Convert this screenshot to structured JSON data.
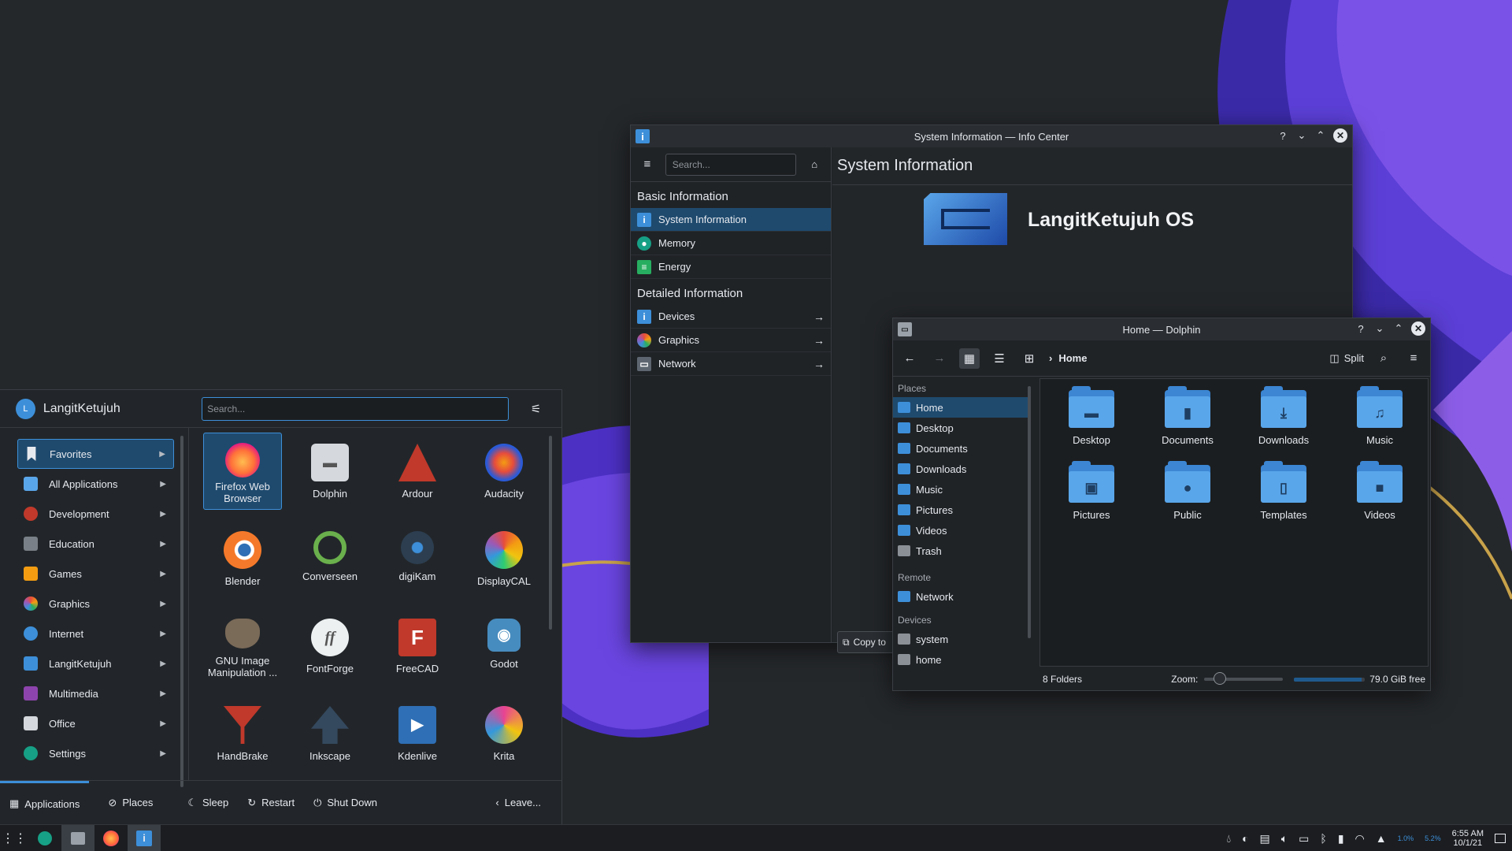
{
  "info_center": {
    "title": "System Information — Info Center",
    "search_placeholder": "Search...",
    "heading": "System Information",
    "basic_header": "Basic Information",
    "detailed_header": "Detailed Information",
    "basic_items": [
      {
        "label": "System Information",
        "icon": "info-icon"
      },
      {
        "label": "Memory",
        "icon": "memory-icon"
      },
      {
        "label": "Energy",
        "icon": "battery-icon"
      }
    ],
    "detailed_items": [
      {
        "label": "Devices",
        "icon": "info-icon"
      },
      {
        "label": "Graphics",
        "icon": "graphics-icon"
      },
      {
        "label": "Network",
        "icon": "network-icon"
      }
    ],
    "os_name": "LangitKetujuh OS",
    "copy_label": "Copy to"
  },
  "dolphin": {
    "title": "Home — Dolphin",
    "breadcrumb": "Home",
    "split_label": "Split",
    "places_header": "Places",
    "places": [
      "Home",
      "Desktop",
      "Documents",
      "Downloads",
      "Music",
      "Pictures",
      "Videos",
      "Trash"
    ],
    "remote_header": "Remote",
    "remote": [
      "Network"
    ],
    "devices_header": "Devices",
    "devices": [
      "system",
      "home"
    ],
    "folders": [
      {
        "name": "Desktop",
        "icon": "desktop-folder-icon"
      },
      {
        "name": "Documents",
        "icon": "documents-folder-icon"
      },
      {
        "name": "Downloads",
        "icon": "downloads-folder-icon"
      },
      {
        "name": "Music",
        "icon": "music-folder-icon"
      },
      {
        "name": "Pictures",
        "icon": "pictures-folder-icon"
      },
      {
        "name": "Public",
        "icon": "public-folder-icon"
      },
      {
        "name": "Templates",
        "icon": "templates-folder-icon"
      },
      {
        "name": "Videos",
        "icon": "videos-folder-icon"
      }
    ],
    "status_count": "8 Folders",
    "zoom_label": "Zoom:",
    "zoom_level": 0.2,
    "free_space": "79.0 GiB free",
    "used_fraction": 0.95
  },
  "launcher": {
    "user": "LangitKetujuh",
    "avatar_letter": "L",
    "search_placeholder": "Search...",
    "categories": [
      {
        "label": "Favorites",
        "color": "#3d8fd9"
      },
      {
        "label": "All Applications",
        "color": "#5aa6ea"
      },
      {
        "label": "Development",
        "color": "#c0392b"
      },
      {
        "label": "Education",
        "color": "#7a8087"
      },
      {
        "label": "Games",
        "color": "#f39c12"
      },
      {
        "label": "Graphics",
        "color": "#e74c3c"
      },
      {
        "label": "Internet",
        "color": "#3d8fd9"
      },
      {
        "label": "LangitKetujuh",
        "color": "#3d8fd9"
      },
      {
        "label": "Multimedia",
        "color": "#8e44ad"
      },
      {
        "label": "Office",
        "color": "#d5d8dc"
      },
      {
        "label": "Settings",
        "color": "#16a085"
      }
    ],
    "apps": [
      {
        "label": "Firefox Web Browser",
        "color": "#ff7139"
      },
      {
        "label": "Dolphin",
        "color": "#d5d8dc"
      },
      {
        "label": "Ardour",
        "color": "#c0392b"
      },
      {
        "label": "Audacity",
        "color": "#2a5ad7"
      },
      {
        "label": "Blender",
        "color": "#f5792a"
      },
      {
        "label": "Converseen",
        "color": "#6ab04c"
      },
      {
        "label": "digiKam",
        "color": "#2c3e50"
      },
      {
        "label": "DisplayCAL",
        "color": "#9b59b6"
      },
      {
        "label": "GNU Image Manipulation ...",
        "color": "#7a6a58"
      },
      {
        "label": "FontForge",
        "color": "#ecf0f1"
      },
      {
        "label": "FreeCAD",
        "color": "#c0392b"
      },
      {
        "label": "Godot",
        "color": "#478cbf"
      },
      {
        "label": "HandBrake",
        "color": "#c0392b"
      },
      {
        "label": "Inkscape",
        "color": "#34495e"
      },
      {
        "label": "Kdenlive",
        "color": "#2f6fb5"
      },
      {
        "label": "Krita",
        "color": "#e84393"
      }
    ],
    "footer": {
      "applications": "Applications",
      "places": "Places",
      "sleep": "Sleep",
      "restart": "Restart",
      "shutdown": "Shut Down",
      "leave": "Leave..."
    }
  },
  "taskbar": {
    "time": "6:55 AM",
    "date": "10/1/21",
    "battery_text": "1.0%",
    "weather_text": "5.2%"
  }
}
